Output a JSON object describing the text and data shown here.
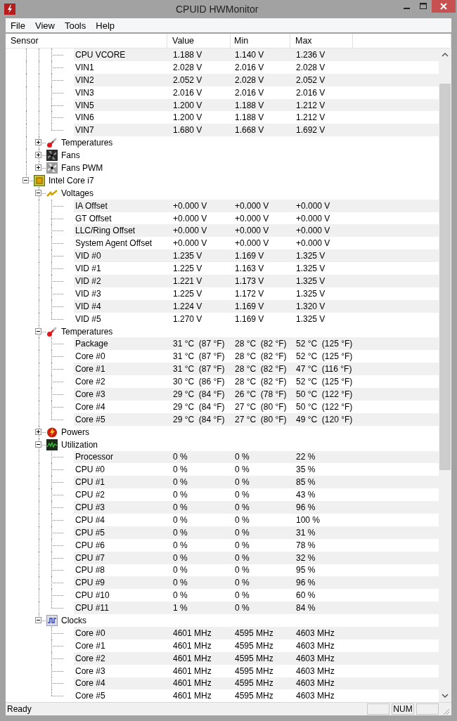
{
  "window": {
    "title": "CPUID HWMonitor"
  },
  "menu": [
    "File",
    "View",
    "Tools",
    "Help"
  ],
  "columns": [
    "Sensor",
    "Value",
    "Min",
    "Max"
  ],
  "tree": [
    {
      "children": [
        {
          "children": [
            {
              "sensor": "CPU VCORE",
              "value": "1.188 V",
              "min": "1.140 V",
              "max": "1.236 V"
            },
            {
              "sensor": "VIN1",
              "value": "2.028 V",
              "min": "2.016 V",
              "max": "2.028 V"
            },
            {
              "sensor": "VIN2",
              "value": "2.052 V",
              "min": "2.028 V",
              "max": "2.052 V"
            },
            {
              "sensor": "VIN3",
              "value": "2.016 V",
              "min": "2.016 V",
              "max": "2.016 V"
            },
            {
              "sensor": "VIN5",
              "value": "1.200 V",
              "min": "1.188 V",
              "max": "1.212 V"
            },
            {
              "sensor": "VIN6",
              "value": "1.200 V",
              "min": "1.188 V",
              "max": "1.212 V"
            },
            {
              "sensor": "VIN7",
              "value": "1.680 V",
              "min": "1.668 V",
              "max": "1.692 V"
            }
          ]
        },
        {
          "label": "Temperatures",
          "kind": "temperature",
          "expanded": false
        },
        {
          "label": "Fans",
          "kind": "fan",
          "expanded": false
        },
        {
          "label": "Fans PWM",
          "kind": "fan-pwm",
          "expanded": false
        }
      ]
    },
    {
      "label": "Intel Core i7",
      "kind": "chip",
      "expanded": true,
      "children": [
        {
          "label": "Voltages",
          "kind": "voltage",
          "expanded": true,
          "children": [
            {
              "sensor": "IA Offset",
              "value": "+0.000 V",
              "min": "+0.000 V",
              "max": "+0.000 V"
            },
            {
              "sensor": "GT Offset",
              "value": "+0.000 V",
              "min": "+0.000 V",
              "max": "+0.000 V"
            },
            {
              "sensor": "LLC/Ring Offset",
              "value": "+0.000 V",
              "min": "+0.000 V",
              "max": "+0.000 V"
            },
            {
              "sensor": "System Agent Offset",
              "value": "+0.000 V",
              "min": "+0.000 V",
              "max": "+0.000 V"
            },
            {
              "sensor": "VID #0",
              "value": "1.235 V",
              "min": "1.169 V",
              "max": "1.325 V"
            },
            {
              "sensor": "VID #1",
              "value": "1.225 V",
              "min": "1.163 V",
              "max": "1.325 V"
            },
            {
              "sensor": "VID #2",
              "value": "1.221 V",
              "min": "1.173 V",
              "max": "1.325 V"
            },
            {
              "sensor": "VID #3",
              "value": "1.225 V",
              "min": "1.172 V",
              "max": "1.325 V"
            },
            {
              "sensor": "VID #4",
              "value": "1.224 V",
              "min": "1.169 V",
              "max": "1.320 V"
            },
            {
              "sensor": "VID #5",
              "value": "1.270 V",
              "min": "1.169 V",
              "max": "1.325 V"
            }
          ]
        },
        {
          "label": "Temperatures",
          "kind": "temperature",
          "expanded": true,
          "children": [
            {
              "sensor": "Package",
              "value": "31 °C  (87 °F)",
              "min": "28 °C  (82 °F)",
              "max": "52 °C  (125 °F)"
            },
            {
              "sensor": "Core #0",
              "value": "31 °C  (87 °F)",
              "min": "28 °C  (82 °F)",
              "max": "52 °C  (125 °F)"
            },
            {
              "sensor": "Core #1",
              "value": "31 °C  (87 °F)",
              "min": "28 °C  (82 °F)",
              "max": "47 °C  (116 °F)"
            },
            {
              "sensor": "Core #2",
              "value": "30 °C  (86 °F)",
              "min": "28 °C  (82 °F)",
              "max": "52 °C  (125 °F)"
            },
            {
              "sensor": "Core #3",
              "value": "29 °C  (84 °F)",
              "min": "26 °C  (78 °F)",
              "max": "50 °C  (122 °F)"
            },
            {
              "sensor": "Core #4",
              "value": "29 °C  (84 °F)",
              "min": "27 °C  (80 °F)",
              "max": "50 °C  (122 °F)"
            },
            {
              "sensor": "Core #5",
              "value": "29 °C  (84 °F)",
              "min": "27 °C  (80 °F)",
              "max": "49 °C  (120 °F)"
            }
          ]
        },
        {
          "label": "Powers",
          "kind": "power",
          "expanded": false
        },
        {
          "label": "Utilization",
          "kind": "utilization",
          "expanded": true,
          "children": [
            {
              "sensor": "Processor",
              "value": "0 %",
              "min": "0 %",
              "max": "22 %"
            },
            {
              "sensor": "CPU #0",
              "value": "0 %",
              "min": "0 %",
              "max": "35 %"
            },
            {
              "sensor": "CPU #1",
              "value": "0 %",
              "min": "0 %",
              "max": "85 %"
            },
            {
              "sensor": "CPU #2",
              "value": "0 %",
              "min": "0 %",
              "max": "43 %"
            },
            {
              "sensor": "CPU #3",
              "value": "0 %",
              "min": "0 %",
              "max": "96 %"
            },
            {
              "sensor": "CPU #4",
              "value": "0 %",
              "min": "0 %",
              "max": "100 %"
            },
            {
              "sensor": "CPU #5",
              "value": "0 %",
              "min": "0 %",
              "max": "31 %"
            },
            {
              "sensor": "CPU #6",
              "value": "0 %",
              "min": "0 %",
              "max": "78 %"
            },
            {
              "sensor": "CPU #7",
              "value": "0 %",
              "min": "0 %",
              "max": "32 %"
            },
            {
              "sensor": "CPU #8",
              "value": "0 %",
              "min": "0 %",
              "max": "95 %"
            },
            {
              "sensor": "CPU #9",
              "value": "0 %",
              "min": "0 %",
              "max": "96 %"
            },
            {
              "sensor": "CPU #10",
              "value": "0 %",
              "min": "0 %",
              "max": "60 %"
            },
            {
              "sensor": "CPU #11",
              "value": "1 %",
              "min": "0 %",
              "max": "84 %"
            }
          ]
        },
        {
          "label": "Clocks",
          "kind": "clock",
          "expanded": true,
          "children": [
            {
              "sensor": "Core #0",
              "value": "4601 MHz",
              "min": "4595 MHz",
              "max": "4603 MHz"
            },
            {
              "sensor": "Core #1",
              "value": "4601 MHz",
              "min": "4595 MHz",
              "max": "4603 MHz"
            },
            {
              "sensor": "Core #2",
              "value": "4601 MHz",
              "min": "4595 MHz",
              "max": "4603 MHz"
            },
            {
              "sensor": "Core #3",
              "value": "4601 MHz",
              "min": "4595 MHz",
              "max": "4603 MHz"
            },
            {
              "sensor": "Core #4",
              "value": "4601 MHz",
              "min": "4595 MHz",
              "max": "4603 MHz"
            },
            {
              "sensor": "Core #5",
              "value": "4601 MHz",
              "min": "4595 MHz",
              "max": "4603 MHz"
            }
          ]
        }
      ]
    }
  ],
  "status_bar": {
    "text": "Ready",
    "panels": [
      "NUM"
    ]
  }
}
